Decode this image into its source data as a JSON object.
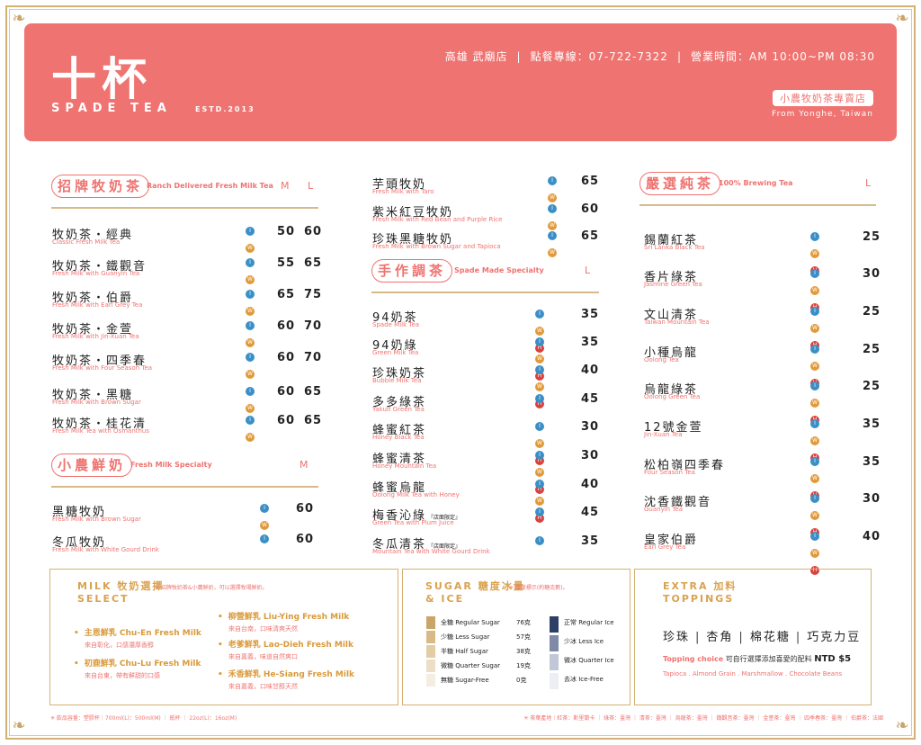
{
  "header": {
    "logo": "十杯",
    "logo_en": "SPADE TEA",
    "estd": "ESTD.2013",
    "store": "高雄 武廟店",
    "phone": "點餐專線：07-722-7322",
    "hours": "營業時間：AM 10:00~PM 08:30",
    "badge": "小農牧奶茶專賣店",
    "from": "From Yonghe, Taiwan"
  },
  "ranch": {
    "title": "招牌牧奶茶",
    "en": "Ranch Delivered Fresh Milk Tea",
    "m": "M",
    "l": "L",
    "items": [
      {
        "zh": "牧奶茶・經典",
        "en": "Classic Fresh Milk Tea",
        "m": "50",
        "l": "60"
      },
      {
        "zh": "牧奶茶・鐵觀音",
        "en": "Fresh Milk with Guanyin Tea",
        "m": "55",
        "l": "65"
      },
      {
        "zh": "牧奶茶・伯爵",
        "en": "Fresh Milk with Earl Grey Tea",
        "m": "65",
        "l": "75"
      },
      {
        "zh": "牧奶茶・金萱",
        "en": "Fresh Milk with Jin-Xuan Tea",
        "m": "60",
        "l": "70"
      },
      {
        "zh": "牧奶茶・四季春",
        "en": "Fresh Milk with Four Season Tea",
        "m": "60",
        "l": "70"
      },
      {
        "zh": "牧奶茶・黑糖",
        "en": "Fresh Milk with Brown Sugar",
        "m": "60",
        "l": "65"
      },
      {
        "zh": "牧奶茶・桂花清",
        "en": "Fresh Milk Tea with Osmanthus",
        "m": "60",
        "l": "65"
      }
    ]
  },
  "fresh": {
    "title": "小農鮮奶",
    "en": "Fresh Milk Specialty",
    "m": "M",
    "items": [
      {
        "zh": "黑糖牧奶",
        "en": "Fresh Milk with Brown Sugar",
        "m": "60"
      },
      {
        "zh": "冬瓜牧奶",
        "en": "Fresh Milk with White Gourd Drink",
        "m": "60"
      }
    ]
  },
  "mid_top": [
    {
      "zh": "芋頭牧奶",
      "en": "Fresh Milk with Taro",
      "p": "65"
    },
    {
      "zh": "紫米紅豆牧奶",
      "en": "Fresh Milk with Red Bean and Purple Rice",
      "p": "60"
    },
    {
      "zh": "珍珠黑糖牧奶",
      "en": "Fresh Milk with Brown Sugar and Tapioca",
      "p": "65"
    }
  ],
  "spade": {
    "title": "手作調茶",
    "en": "Spade Made Specialty",
    "l": "L",
    "limited": "『店面限定』",
    "items": [
      {
        "zh": "94奶茶",
        "en": "Spade Milk Tea",
        "p": "35"
      },
      {
        "zh": "94奶綠",
        "en": "Green Milk Tea",
        "p": "35"
      },
      {
        "zh": "珍珠奶茶",
        "en": "Bubble Milk Tea",
        "p": "40"
      },
      {
        "zh": "多多綠茶",
        "en": "Yakult Green Tea",
        "p": "45"
      },
      {
        "zh": "蜂蜜紅茶",
        "en": "Honey Black Tea",
        "p": "30"
      },
      {
        "zh": "蜂蜜清茶",
        "en": "Honey Mountain Tea",
        "p": "30"
      },
      {
        "zh": "蜂蜜烏龍",
        "en": "Oolong Milk Tea with Honey",
        "p": "40"
      },
      {
        "zh": "梅香沁綠",
        "en": "Green Tea with Plum Juice",
        "p": "45"
      },
      {
        "zh": "冬瓜清茶",
        "en": "Mountain Tea with White Gourd Drink",
        "p": "35"
      }
    ]
  },
  "brew": {
    "title": "嚴選純茶",
    "en": "100% Brewing Tea",
    "l": "L",
    "items": [
      {
        "zh": "錫蘭紅茶",
        "en": "Sri Lanka Black Tea",
        "p": "25"
      },
      {
        "zh": "香片綠茶",
        "en": "Jasmine Green Tea",
        "p": "30"
      },
      {
        "zh": "文山清茶",
        "en": "Taiwan Mountain Tea",
        "p": "25"
      },
      {
        "zh": "小種烏龍",
        "en": "Oolong Tea",
        "p": "25"
      },
      {
        "zh": "烏龍綠茶",
        "en": "Oolong Green Tea",
        "p": "25"
      },
      {
        "zh": "12號金萱",
        "en": "Jin-Xuan Tea",
        "p": "35"
      },
      {
        "zh": "松柏嶺四季春",
        "en": "Four Season Tea",
        "p": "35"
      },
      {
        "zh": "沈香鐵觀音",
        "en": "Guanyin Tea",
        "p": "30"
      },
      {
        "zh": "皇家伯爵",
        "en": "Earl Grey Tea",
        "p": "40"
      }
    ]
  },
  "milk_sel": {
    "t1": "MILK",
    "t1zh": "牧奶選擇",
    "t2": "SELECT",
    "note": "✳ 招牌牧奶茶&小農鮮奶，可以選擇牧場鮮奶。",
    "items": [
      {
        "name": "主恩鮮乳",
        "en": "Chu-En Fresh Milk",
        "sub": "來自彰化，口感濃厚香醇"
      },
      {
        "name": "初鹿鮮乳",
        "en": "Chu-Lu Fresh Milk",
        "sub": "來自台東，帶有鮮甜的口感"
      },
      {
        "name": "柳營鮮乳",
        "en": "Liu-Ying Fresh Milk",
        "sub": "來自台南，口味清爽天然"
      },
      {
        "name": "老爹鮮乳",
        "en": "Lao-Dieh Fresh Milk",
        "sub": "來自嘉義，味道自然爽口"
      },
      {
        "name": "禾香鮮乳",
        "en": "He-Siang Fresh Milk",
        "sub": "來自嘉義，口味甘醇天然"
      }
    ]
  },
  "sugar": {
    "t1": "SUGAR",
    "t1zh": "糖度冰量",
    "t2": "& ICE",
    "note": "✳ 甜度標示(約糖克數)。",
    "items": [
      {
        "zh": "全糖",
        "en": "Regular Sugar",
        "g": "76克"
      },
      {
        "zh": "少糖",
        "en": "Less Sugar",
        "g": "57克"
      },
      {
        "zh": "半糖",
        "en": "Half Sugar",
        "g": "38克"
      },
      {
        "zh": "微糖",
        "en": "Quarter Sugar",
        "g": "19克"
      },
      {
        "zh": "無糖",
        "en": "Sugar-Free",
        "g": "0克"
      }
    ],
    "ice": [
      {
        "zh": "正常",
        "en": "Regular Ice"
      },
      {
        "zh": "少冰",
        "en": "Less Ice"
      },
      {
        "zh": "微冰",
        "en": "Quarter Ice"
      },
      {
        "zh": "去冰",
        "en": "Ice-Free"
      }
    ]
  },
  "extra": {
    "t1": "EXTRA",
    "t1zh": "加料",
    "t2": "TOPPINGS",
    "items": [
      "珍珠",
      "杏角",
      "棉花糖",
      "巧克力豆"
    ],
    "choice": "Topping choice",
    "choice_zh": "可自行選擇添加喜愛的配料",
    "price": "NTD $5",
    "en": "Tapioca . Almond Grain . Marshmallow . Chocolate Beans"
  },
  "footer": {
    "left": "✳ 飲品容量：塑膠杯｜700ml(L)：500ml(M) ｜ 紙杯 ｜ 22oz(L)：16oz(M)",
    "right": "✳ 茶葉產地｜紅茶：斯里蘭卡 ｜ 綠茶：臺灣 ｜ 清茶：臺灣 ｜ 烏龍茶：臺灣 ｜ 鐵觀音茶：臺灣 ｜ 金萱茶：臺灣 ｜ 四季春茶：臺灣 ｜ 伯爵茶：法國"
  },
  "colors": {
    "accent": "#ef7370",
    "gold": "#d4b172",
    "ice_blue": "#3a8fc6",
    "warm_orange": "#e19a3b",
    "hot_red": "#d9433f"
  }
}
